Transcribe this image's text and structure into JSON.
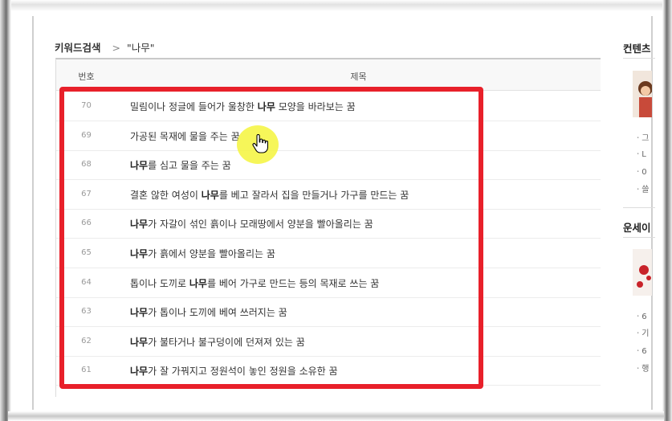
{
  "breadcrumb": {
    "title": "키워드검색",
    "separator": ">",
    "keyword": "\"나무\""
  },
  "table": {
    "columns": {
      "number": "번호",
      "title": "제목"
    },
    "rows": [
      {
        "num": "70",
        "pre": "밀림이나 정글에 들어가 울창한 ",
        "keyword": "나무",
        "post": " 모양을 바라보는 꿈"
      },
      {
        "num": "69",
        "pre": "가공된 목재에 물을 주는 꿈",
        "keyword": "",
        "post": ""
      },
      {
        "num": "68",
        "pre": "",
        "keyword": "나무",
        "post": "를 심고 물을 주는 꿈"
      },
      {
        "num": "67",
        "pre": "결혼 않한 여성이 ",
        "keyword": "나무",
        "post": "를 베고 잘라서 집을 만들거나 가구를 만드는 꿈"
      },
      {
        "num": "66",
        "pre": "",
        "keyword": "나무",
        "post": "가 자갈이 섞인 흙이나 모래땅에서 양분을 빨아올리는 꿈"
      },
      {
        "num": "65",
        "pre": "",
        "keyword": "나무",
        "post": "가 흙에서 양분을 빨아올리는 꿈"
      },
      {
        "num": "64",
        "pre": "톱이나 도끼로 ",
        "keyword": "나무",
        "post": "를 베어 가구로 만드는 등의 목재로 쓰는 꿈"
      },
      {
        "num": "63",
        "pre": "",
        "keyword": "나무",
        "post": "가 톱이나 도끼에 베여 쓰러지는 꿈"
      },
      {
        "num": "62",
        "pre": "",
        "keyword": "나무",
        "post": "가 불타거나 불구덩이에 던져져 있는 꿈"
      },
      {
        "num": "61",
        "pre": "",
        "keyword": "나무",
        "post": "가 잘 가꿔지고 정원석이 놓인 정원을 소유한 꿈"
      }
    ]
  },
  "sidebar": {
    "section1_title": "컨텐츠",
    "section1_items": [
      "ㆍ그",
      "ㆍL",
      "ㆍ0",
      "ㆍ쓸"
    ],
    "section2_title": "운세이",
    "section2_items": [
      "ㆍ6",
      "ㆍ기",
      "ㆍ6",
      "ㆍ행"
    ]
  },
  "colors": {
    "highlight": "#e8202a",
    "cursor_halo": "#f5f53c"
  }
}
